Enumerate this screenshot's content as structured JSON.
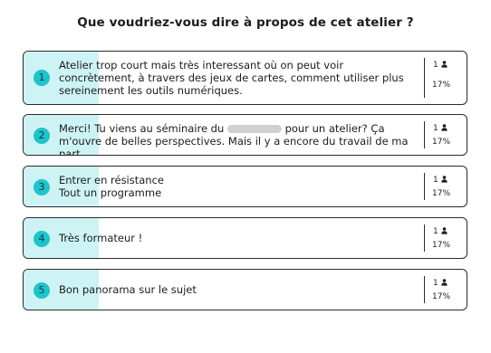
{
  "title": "Que voudriez-vous dire à propos de cet atelier ?",
  "accent_color": "#1ec4cd",
  "bar_color": "#cdf3f5",
  "responses": [
    {
      "number": "1",
      "lines": [
        "Atelier trop court mais très interessant où on peut voir concrètement, à travers des jeux de cartes, comment utiliser plus sereinement les outils numériques."
      ],
      "count": "1",
      "percent": "17%",
      "share": 0.17
    },
    {
      "number": "2",
      "text_before": "Merci! Tu viens au séminaire du ",
      "text_after": " pour un atelier? Ça m'ouvre de belles perspectives. Mais il y a encore du travail de ma part.",
      "count": "1",
      "percent": "17%",
      "share": 0.17
    },
    {
      "number": "3",
      "lines": [
        "Entrer en résistance",
        "Tout un programme"
      ],
      "count": "1",
      "percent": "17%",
      "share": 0.17
    },
    {
      "number": "4",
      "lines": [
        "Très formateur !"
      ],
      "count": "1",
      "percent": "17%",
      "share": 0.17
    },
    {
      "number": "5",
      "lines": [
        "Bon panorama sur le sujet"
      ],
      "count": "1",
      "percent": "17%",
      "share": 0.17
    }
  ]
}
